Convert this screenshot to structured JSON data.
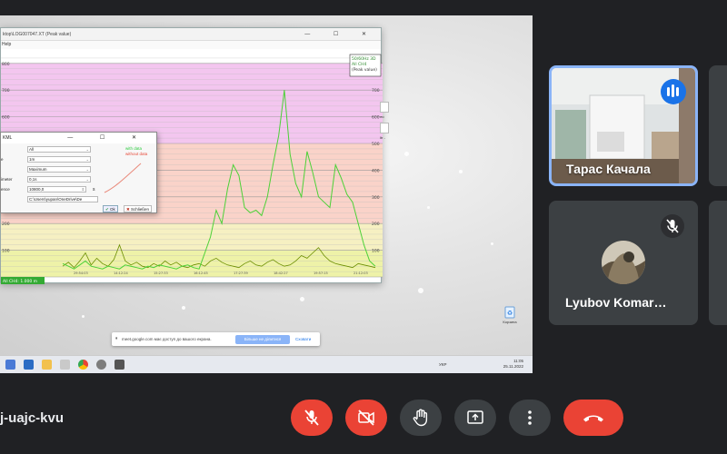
{
  "app_window": {
    "title": "ktop\\LOG007047.XT (Peak value)",
    "menu_help": "Help",
    "window_controls": [
      "—",
      "☐",
      "✕"
    ]
  },
  "chart_data": {
    "type": "line",
    "title": "",
    "legend": [
      "50/60Hz 3D",
      "All CH4",
      "(Peak value)"
    ],
    "status_label": "All CH4: 1.000 m",
    "y_ticks_right": [
      "800",
      "700",
      "600",
      "500",
      "400",
      "300",
      "200",
      "100"
    ],
    "y_ticks_left": [
      "800",
      "700",
      "600",
      "500",
      "400",
      "300",
      "200",
      "100"
    ],
    "bands": [
      {
        "from": 500,
        "to": 800,
        "color": "#f3c6ef"
      },
      {
        "from": 200,
        "to": 500,
        "color": "#fad3c9"
      },
      {
        "from": 100,
        "to": 200,
        "color": "#f6f0c2"
      },
      {
        "from": 0,
        "to": 100,
        "color": "#eef2a8"
      }
    ],
    "ylim": [
      0,
      830
    ],
    "series": [
      {
        "color": "#6b8e00",
        "values": [
          40,
          55,
          35,
          60,
          90,
          45,
          70,
          50,
          40,
          65,
          120,
          60,
          45,
          55,
          40,
          35,
          50,
          40,
          60,
          45,
          55,
          40,
          35,
          45,
          50,
          40,
          60,
          70,
          55,
          45,
          40,
          35,
          50,
          60,
          45,
          40,
          55,
          65,
          50,
          40,
          45,
          60,
          80,
          70,
          90,
          110,
          80,
          60,
          50,
          45,
          40,
          35,
          50,
          45,
          40,
          35
        ]
      },
      {
        "color": "#4cd137",
        "values": [
          50,
          40,
          30,
          45,
          60,
          40,
          35,
          30,
          40,
          35,
          30,
          45,
          40,
          35,
          30,
          40,
          35,
          45,
          40,
          35,
          30,
          40,
          45,
          35,
          30,
          90,
          150,
          250,
          200,
          330,
          420,
          380,
          260,
          240,
          250,
          230,
          300,
          420,
          530,
          700,
          460,
          350,
          300,
          470,
          390,
          300,
          280,
          260,
          420,
          370,
          310,
          280,
          200,
          120,
          60,
          40
        ]
      }
    ],
    "bottom_labels": [
      "29:54:03",
      "14:12:24",
      "15:27:33",
      "16:12:45",
      "17:27:39",
      "18:42:27",
      "19:57:15",
      "21:12:03"
    ]
  },
  "dialog": {
    "title": "KML",
    "rows": [
      {
        "label": "",
        "value": "All"
      },
      {
        "label": "e",
        "value": "1m"
      },
      {
        "label": "",
        "value": "Maximum"
      },
      {
        "label": "imeter",
        "value": "0,1s"
      },
      {
        "label": "ence",
        "value": "10800,0"
      }
    ],
    "unit_s": "s",
    "path": "C:\\Users\\yupan\\OneDrive\\De",
    "with_data": "with data",
    "without_data": "without data",
    "ok_label": "Ok",
    "close_label": "Schließen"
  },
  "desktop": {
    "right_labels": [
      "ло",
      "ltr -"
    ],
    "recycle_label": "Корзина"
  },
  "share_bar": {
    "message": "meet.google.com має доступ до вашого екрана.",
    "stop_label": "Більше не ділитися",
    "hide_label": "Сховати"
  },
  "taskbar": {
    "lang": "УКР",
    "time": "11:05",
    "date": "25.11.2022"
  },
  "participants": [
    {
      "name": "Тарас Качала",
      "speaking": true
    },
    {
      "name": "Lyubov Komar…",
      "muted": true
    }
  ],
  "meeting_code": "j-uajc-kvu",
  "colors": {
    "accent": "#8ab4f8",
    "danger": "#ea4335",
    "control": "#3c4043",
    "bg": "#202124"
  }
}
